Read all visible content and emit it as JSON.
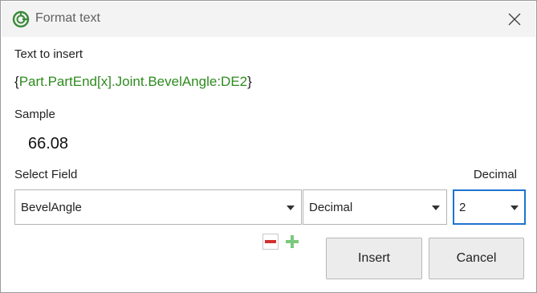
{
  "window": {
    "title": "Format text",
    "app_icon": "fluke-logo-icon",
    "close_icon": "close-icon"
  },
  "text_to_insert": {
    "label": "Text to insert",
    "open_brace": "{",
    "expression": "Part.PartEnd[x].Joint.BevelAngle:DE2",
    "close_brace": "}"
  },
  "sample": {
    "label": "Sample",
    "value": "66.08"
  },
  "select_field": {
    "label": "Select Field",
    "decimal_label": "Decimal",
    "field_value": "BevelAngle",
    "type_value": "Decimal",
    "decimal_value": "2"
  },
  "icons": {
    "remove": "minus-icon",
    "add": "plus-icon"
  },
  "buttons": {
    "insert": "Insert",
    "cancel": "Cancel"
  },
  "colors": {
    "expression_green": "#2e8b1f",
    "remove_red": "#d23030",
    "add_green": "#5cb85c",
    "focus_blue": "#1e73d1"
  }
}
